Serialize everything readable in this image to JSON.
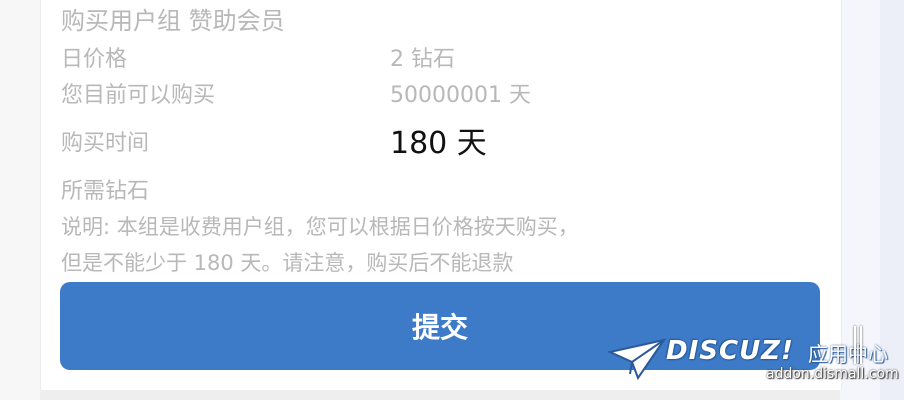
{
  "form": {
    "title": "购买用户组 赞助会员",
    "daily_price_label": "日价格",
    "daily_price_value": "2 钻石",
    "max_days_label": "您目前可以购买",
    "max_days_value": "50000001 天",
    "duration_label": "购买时间",
    "duration_value": "180 天",
    "diamonds_needed_label": "所需钻石",
    "note_line1": "说明: 本组是收费用户组，您可以根据日价格按天购买，",
    "note_line2": "但是不能少于 180 天。请注意，购买后不能退款",
    "submit_label": "提交"
  },
  "watermark": {
    "brand": "DISCUZ!",
    "brand_cn": "应用中心",
    "url": "addon.dismall.com"
  },
  "colors": {
    "muted_text": "#b8b8b8",
    "submit_bg": "#3d7bc8"
  }
}
